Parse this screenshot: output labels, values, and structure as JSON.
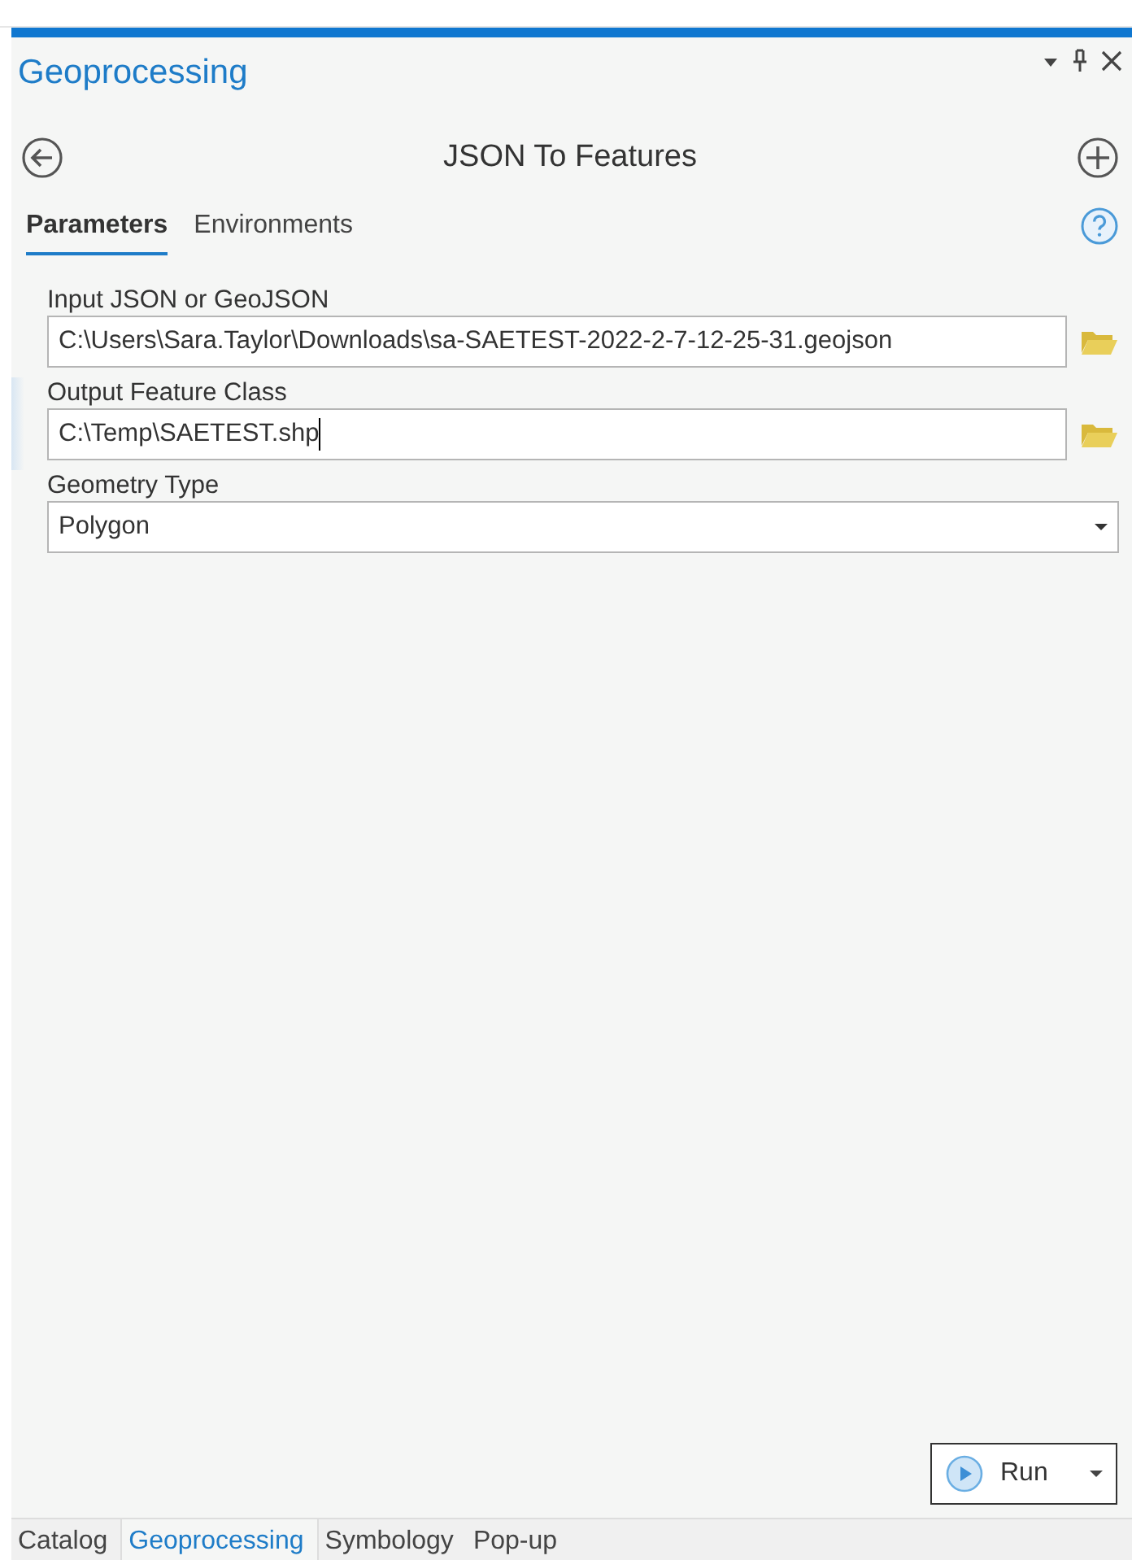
{
  "pane": {
    "title": "Geoprocessing"
  },
  "tool": {
    "title": "JSON To Features"
  },
  "tabs": [
    {
      "label": "Parameters",
      "selected": true
    },
    {
      "label": "Environments",
      "selected": false
    }
  ],
  "parameters": [
    {
      "kind": "file",
      "label": "Input JSON or GeoJSON",
      "value": "C:\\Users\\Sara.Taylor\\Downloads\\sa-SAETEST-2022-2-7-12-25-31.geojson",
      "selected": false
    },
    {
      "kind": "file",
      "label": "Output Feature Class",
      "value": "C:\\Temp\\SAETEST.shp",
      "selected": true
    },
    {
      "kind": "dropdown",
      "label": "Geometry Type",
      "value": "Polygon",
      "selected": false
    }
  ],
  "run_button": {
    "label": "Run"
  },
  "bottom_tabs": [
    {
      "label": "Catalog",
      "selected": false
    },
    {
      "label": "Geoprocessing",
      "selected": true
    },
    {
      "label": "Symbology",
      "selected": false
    },
    {
      "label": "Pop-up",
      "selected": false
    }
  ]
}
